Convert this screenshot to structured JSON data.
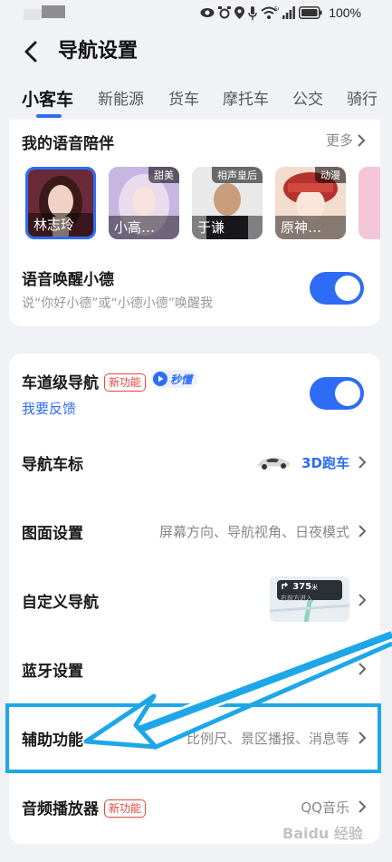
{
  "status_bar": {
    "battery_percent": "100%",
    "icons": [
      "eye-icon",
      "alarm-icon",
      "location-icon",
      "mic-icon",
      "wifi-icon",
      "signal-icon",
      "battery-icon"
    ]
  },
  "header": {
    "title": "导航设置",
    "back_icon": "back-arrow-icon"
  },
  "tabs": [
    {
      "label": "小客车",
      "active": true
    },
    {
      "label": "新能源",
      "active": false
    },
    {
      "label": "货车",
      "active": false
    },
    {
      "label": "摩托车",
      "active": false
    },
    {
      "label": "公交",
      "active": false
    },
    {
      "label": "骑行",
      "active": false
    }
  ],
  "voice_section": {
    "title": "我的语音陪伴",
    "more_label": "更多",
    "voices": [
      {
        "name": "林志玲",
        "tag": "",
        "selected": true
      },
      {
        "name": "小高…",
        "tag": "甜美",
        "selected": false
      },
      {
        "name": "于谦",
        "tag": "相声皇后",
        "selected": false
      },
      {
        "name": "原神…",
        "tag": "动漫",
        "selected": false
      }
    ],
    "wake": {
      "title": "语音唤醒小德",
      "subtitle": "说“你好小德”或“小德小德”唤醒我",
      "enabled": true
    }
  },
  "settings": {
    "lane_nav": {
      "title": "车道级导航",
      "new_badge": "新功能",
      "sec_badge": "秒懂",
      "feedback": "我要反馈",
      "enabled": true
    },
    "car_icon": {
      "title": "导航车标",
      "value": "3D跑车"
    },
    "map_settings": {
      "title": "图面设置",
      "value": "屏幕方向、导航视角、日夜模式"
    },
    "custom_nav": {
      "title": "自定义导航",
      "preview_distance": "375",
      "preview_unit": "米",
      "preview_text": "右前方进入"
    },
    "bluetooth": {
      "title": "蓝牙设置"
    },
    "accessibility": {
      "title": "辅助功能",
      "value": "比例尺、景区播报、消息等"
    },
    "audio_player": {
      "title": "音频播放器",
      "new_badge": "新功能",
      "value": "QQ音乐"
    }
  },
  "watermark": "Baidu 经验",
  "colors": {
    "accent": "#2e6cf6",
    "badge_red": "#e8453c",
    "highlight": "#1ea7e8",
    "background": "#f1f2f5"
  }
}
